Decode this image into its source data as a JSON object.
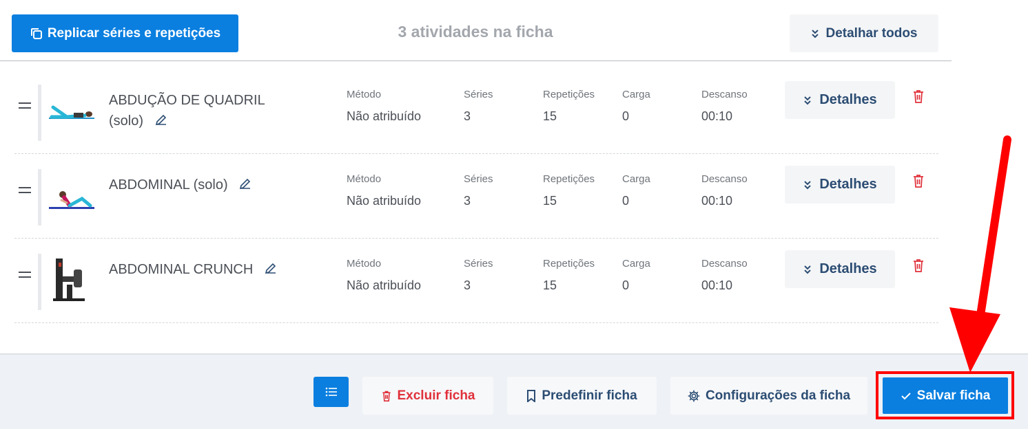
{
  "header": {
    "replicar_label": "Replicar séries e repetições",
    "count_title": "3 atividades na ficha",
    "detalhar_todos_label": "Detalhar todos"
  },
  "columns": {
    "metodo": "Método",
    "series": "Séries",
    "repeticoes": "Repetições",
    "carga": "Carga",
    "descanso": "Descanso"
  },
  "activities": [
    {
      "name": "ABDUÇÃO DE QUADRIL (solo)",
      "metodo": "Não atribuído",
      "series": "3",
      "repeticoes": "15",
      "carga": "0",
      "descanso": "00:10",
      "detalhes_label": "Detalhes",
      "thumb_icon": "side-lying-leg-raise-image"
    },
    {
      "name": "ABDOMINAL (solo)",
      "metodo": "Não atribuído",
      "series": "3",
      "repeticoes": "15",
      "carga": "0",
      "descanso": "00:10",
      "detalhes_label": "Detalhes",
      "thumb_icon": "crunch-on-mat-image"
    },
    {
      "name": "ABDOMINAL CRUNCH",
      "metodo": "Não atribuído",
      "series": "3",
      "repeticoes": "15",
      "carga": "0",
      "descanso": "00:10",
      "detalhes_label": "Detalhes",
      "thumb_icon": "crunch-machine-image"
    }
  ],
  "footer": {
    "excluir_label": "Excluir ficha",
    "predefinir_label": "Predefinir ficha",
    "config_label": "Configurações da ficha",
    "salvar_label": "Salvar ficha"
  },
  "colors": {
    "primary": "#0a7fe0",
    "dark_text": "#2c4d73",
    "danger": "#e0303a",
    "highlight": "#ff0000",
    "footer_bg": "#eef1f5"
  }
}
